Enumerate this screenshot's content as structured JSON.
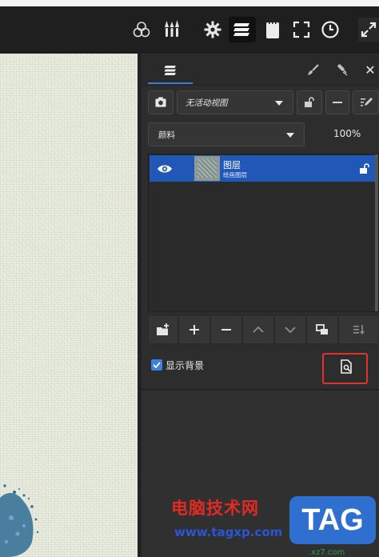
{
  "toolbar": {
    "icons": [
      "color-wheel-icon",
      "brushes-icon",
      "settings-icon",
      "layers-icon",
      "notepad-icon",
      "fullscreen-icon",
      "clock-icon",
      "expand-icon"
    ]
  },
  "panel": {
    "view_select": {
      "value": "无活动视图"
    },
    "blend_select": {
      "value": "颜料"
    },
    "opacity": "100%",
    "layer": {
      "name": "图层",
      "subtitle": "绘画图层"
    },
    "show_background": {
      "label": "显示背景",
      "checked": true
    }
  },
  "watermark": {
    "title": "电脑技术网",
    "url": "www.tagxp.com",
    "tag": "TAG",
    "small": ".xz7.com"
  },
  "colors": {
    "accent": "#2158b8",
    "highlight": "#e0342b"
  }
}
